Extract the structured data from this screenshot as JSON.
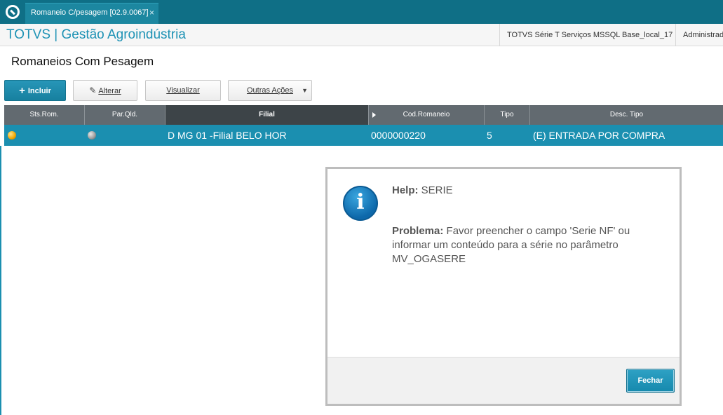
{
  "tab": {
    "title": "Romaneio C/pesagem [02.9.0067]",
    "close_icon": "×"
  },
  "header": {
    "brand": "TOTVS | Gestão Agroindústria",
    "environment": "TOTVS Série T Serviços MSSQL Base_local_17",
    "user": "Administrador"
  },
  "page": {
    "title": "Romaneios Com Pesagem"
  },
  "toolbar": {
    "incluir": "Incluir",
    "alterar": "Alterar",
    "visualizar": "Visualizar",
    "outras_acoes": "Outras Ações"
  },
  "grid": {
    "columns": [
      "Sts.Rom.",
      "Par.Qld.",
      "Filial",
      "Cod.Romaneio",
      "Tipo",
      "Desc. Tipo"
    ],
    "rows": [
      {
        "sts_rom": "orange",
        "par_qld": "gray",
        "filial": "D MG 01 -Filial BELO HOR",
        "cod_romaneio": "0000000220",
        "tipo": "5",
        "desc_tipo": "(E) ENTRADA POR COMPRA"
      }
    ]
  },
  "dialog": {
    "icon": "info-icon",
    "help_label": "Help:",
    "help_value": "SERIE",
    "problem_label": "Problema:",
    "problem_text": "Favor preencher o campo 'Serie NF' ou informar um conteúdo para a série no parâmetro MV_OGASERE",
    "close_button": "Fechar"
  },
  "colors": {
    "topbar": "#0f6f86",
    "accent": "#1b8fb0",
    "grid_header": "#626a70"
  }
}
